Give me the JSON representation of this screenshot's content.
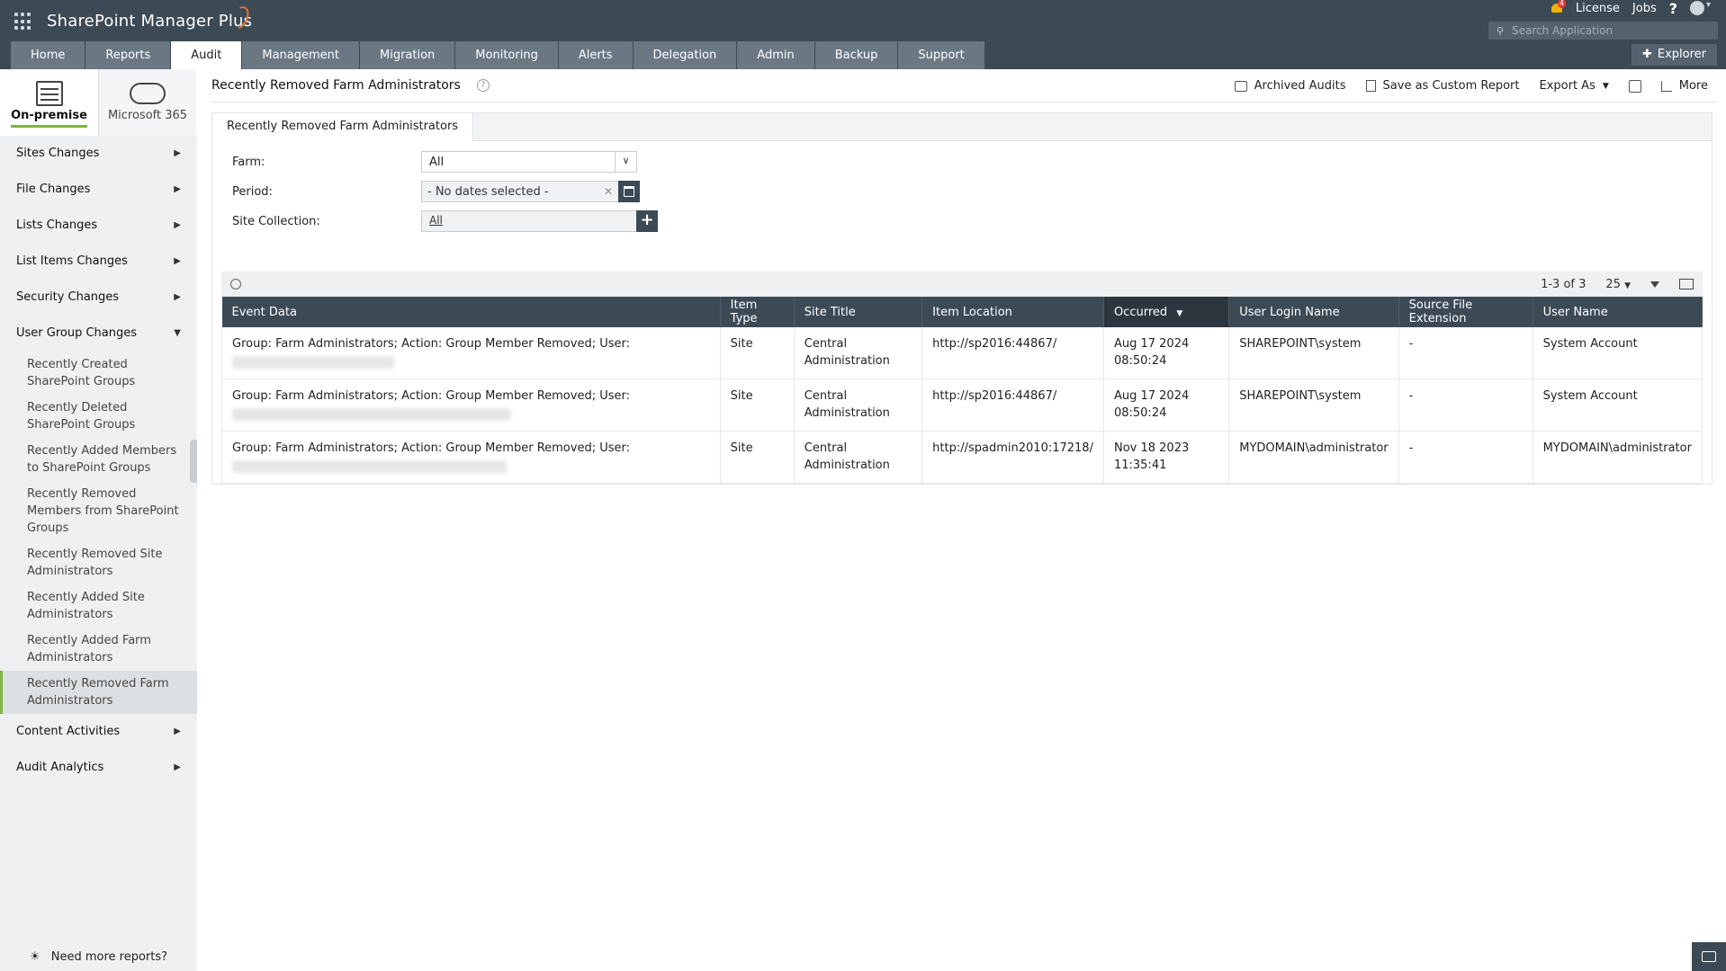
{
  "header": {
    "app_title": "SharePoint Manager Plus",
    "notification_count": "4",
    "links": {
      "license": "License",
      "jobs": "Jobs",
      "help": "?"
    },
    "search_placeholder": "Search Application",
    "explorer_label": "Explorer"
  },
  "tabs": [
    {
      "label": "Home"
    },
    {
      "label": "Reports"
    },
    {
      "label": "Audit",
      "active": true
    },
    {
      "label": "Management"
    },
    {
      "label": "Migration"
    },
    {
      "label": "Monitoring"
    },
    {
      "label": "Alerts"
    },
    {
      "label": "Delegation"
    },
    {
      "label": "Admin"
    },
    {
      "label": "Backup"
    },
    {
      "label": "Support"
    }
  ],
  "sidebar": {
    "modes": {
      "onprem": "On-premise",
      "m365": "Microsoft 365"
    },
    "groups": [
      {
        "label": "Sites Changes"
      },
      {
        "label": "File Changes"
      },
      {
        "label": "Lists Changes"
      },
      {
        "label": "List Items Changes"
      },
      {
        "label": "Security Changes"
      },
      {
        "label": "User Group Changes"
      }
    ],
    "subitems": [
      "Recently Created SharePoint Groups",
      "Recently Deleted SharePoint Groups",
      "Recently Added Members to SharePoint Groups",
      "Recently Removed Members from SharePoint Groups",
      "Recently Removed Site Administrators",
      "Recently Added Site Administrators",
      "Recently Added Farm Administrators",
      "Recently Removed Farm Administrators"
    ],
    "groups_after": [
      {
        "label": "Content Activities"
      },
      {
        "label": "Audit Analytics"
      }
    ],
    "footer": "Need more reports?"
  },
  "page": {
    "title": "Recently Removed Farm Administrators",
    "actions": {
      "archived": "Archived Audits",
      "save_custom": "Save as Custom Report",
      "export": "Export As",
      "more": "More"
    },
    "panel_tab": "Recently Removed Farm Administrators"
  },
  "filters": {
    "farm_label": "Farm:",
    "farm_value": "All",
    "period_label": "Period:",
    "period_value": "- No dates selected -",
    "site_label": "Site Collection:",
    "site_value": "All"
  },
  "grid": {
    "pagination": "1-3 of 3",
    "page_size": "25",
    "columns": [
      "Event Data",
      "Item Type",
      "Site Title",
      "Item Location",
      "Occurred",
      "User Login Name",
      "Source File Extension",
      "User Name"
    ],
    "sorted_column": "Occurred",
    "rows": [
      {
        "event": "Group: Farm Administrators; Action: Group Member Removed; User:",
        "item_type": "Site",
        "site_title": "Central Administration",
        "location": "http://sp2016:44867/",
        "occurred": "Aug 17 2024 08:50:24",
        "login": "SHAREPOINT\\system",
        "ext": "-",
        "user_name": "System Account"
      },
      {
        "event": "Group: Farm Administrators; Action: Group Member Removed; User:",
        "item_type": "Site",
        "site_title": "Central Administration",
        "location": "http://sp2016:44867/",
        "occurred": "Aug 17 2024 08:50:24",
        "login": "SHAREPOINT\\system",
        "ext": "-",
        "user_name": "System Account"
      },
      {
        "event": "Group: Farm Administrators; Action: Group Member Removed; User:",
        "item_type": "Site",
        "site_title": "Central Administration",
        "location": "http://spadmin2010:17218/",
        "occurred": "Nov 18 2023 11:35:41",
        "login": "MYDOMAIN\\administrator",
        "ext": "-",
        "user_name": "MYDOMAIN\\administrator"
      }
    ]
  },
  "colors": {
    "header_bg": "#3c4a55",
    "tab_bg": "#6b7883",
    "accent_green": "#7cb342",
    "bell": "#f0b400"
  }
}
